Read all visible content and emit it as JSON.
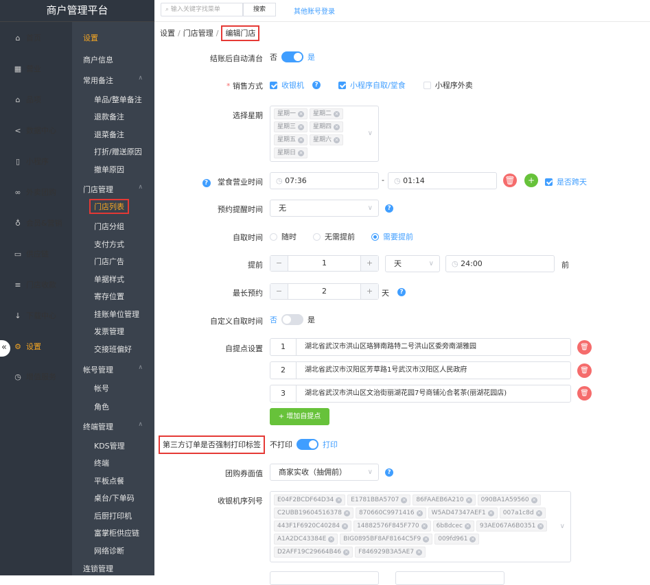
{
  "app": {
    "title": "商户管理平台"
  },
  "nav": {
    "items": [
      {
        "label": "首页",
        "icon": "home-icon",
        "glyph": "⌂"
      },
      {
        "label": "营业",
        "icon": "calendar-icon",
        "glyph": "▦"
      },
      {
        "label": "品项",
        "icon": "bag-icon",
        "glyph": "⌂"
      },
      {
        "label": "数据中心",
        "icon": "share-icon",
        "glyph": "<"
      },
      {
        "label": "小程序",
        "icon": "phone-icon",
        "glyph": "▯"
      },
      {
        "label": "外卖团购",
        "icon": "bike-icon",
        "glyph": "∞"
      },
      {
        "label": "会员&营销",
        "icon": "user-icon",
        "glyph": "♁"
      },
      {
        "label": "供应链",
        "icon": "truck-icon",
        "glyph": "▭"
      },
      {
        "label": "门店收款",
        "icon": "database-icon",
        "glyph": "≡"
      },
      {
        "label": "下载中心",
        "icon": "download-icon",
        "glyph": "↓"
      },
      {
        "label": "设置",
        "icon": "gear-icon",
        "glyph": "⚙"
      },
      {
        "label": "增值服务",
        "icon": "clock-icon",
        "glyph": "◷"
      }
    ],
    "collapse_glyph": "«"
  },
  "subnav": {
    "title": "设置",
    "groups": {
      "merchant_info": "商户信息",
      "common_remarks": "常用备注",
      "remarks": [
        "单品/整单备注",
        "退款备注",
        "退菜备注",
        "打折/赠送原因",
        "撤单原因"
      ],
      "store_mgmt": "门店管理",
      "store_items": [
        "门店列表",
        "门店分组",
        "支付方式",
        "门店广告",
        "单据样式",
        "寄存位置",
        "挂账单位管理",
        "发票管理",
        "交接班偏好"
      ],
      "account_mgmt": "帐号管理",
      "account_items": [
        "帐号",
        "角色"
      ],
      "terminal_mgmt": "终端管理",
      "terminal_items": [
        "KDS管理",
        "终端",
        "平板点餐",
        "桌台/下单码",
        "后厨打印机",
        "富掌柜供应链",
        "网络诊断"
      ],
      "conn_mgmt": "连锁管理"
    }
  },
  "topbar": {
    "search_placeholder": "输入关键字找菜单",
    "search_button": "搜索",
    "other_login": "其他账号登录"
  },
  "breadcrumb": {
    "a": "设置",
    "b": "门店管理",
    "c": "编辑门店",
    "sep": "/"
  },
  "form": {
    "auto_clear": {
      "label": "结账后自动清台",
      "off": "否",
      "on": "是",
      "value": true
    },
    "sales": {
      "label": "销售方式",
      "required": "*",
      "options": [
        {
          "label": "收银机",
          "checked": true
        },
        {
          "label": "小程序自取/堂食",
          "checked": true
        },
        {
          "label": "小程序外卖",
          "checked": false
        }
      ]
    },
    "weekday": {
      "label": "选择星期",
      "tags": [
        "星期一",
        "星期二",
        "星期三",
        "星期四",
        "星期五",
        "星期六",
        "星期日"
      ]
    },
    "dine_hours": {
      "label": "堂食营业时间",
      "start": "07:36",
      "dash": "-",
      "end": "01:14",
      "cross_day": "是否跨天",
      "cross_checked": true
    },
    "reserve_remind": {
      "label": "预约提醒时间",
      "value": "无"
    },
    "pickup": {
      "label": "自取时间",
      "options": [
        "随时",
        "无需提前",
        "需要提前"
      ],
      "selected": 2
    },
    "advance": {
      "label": "提前",
      "minus": "−",
      "value": "1",
      "plus": "+",
      "unit": "天",
      "time": "24:00",
      "suffix": "前"
    },
    "max_reserve": {
      "label": "最长预约",
      "minus": "−",
      "value": "2",
      "plus": "+",
      "unit": "天"
    },
    "custom_pickup": {
      "label": "自定义自取时间",
      "off": "否",
      "on": "是",
      "value": false
    },
    "pickup_points": {
      "label": "自提点设置",
      "items": [
        {
          "no": "1",
          "addr": "湖北省武汉市洪山区珞狮南路特二号洪山区委旁南湖雅园"
        },
        {
          "no": "2",
          "addr": "湖北省武汉市汉阳区芳草路1号武汉市汉阳区人民政府"
        },
        {
          "no": "3",
          "addr": "湖北省武汉市洪山区文治街丽湖花园7号商铺沁合茗茶(丽湖花园店)"
        }
      ],
      "add": "+ 增加自提点"
    },
    "third_party": {
      "label": "第三方订单是否强制打印标签",
      "off": "不打印",
      "on": "打印",
      "value": true
    },
    "coupon": {
      "label": "团购券面值",
      "value": "商家实收（抽佣前）"
    },
    "serials": {
      "label": "收银机序列号",
      "tags": [
        "E04F2BCDF64D34",
        "E1781BBA5707",
        "86FAAEB6A210",
        "090BA1A59560",
        "C2UBB19604516378",
        "870660C9971416",
        "W5AD47347AEF1",
        "007a1c8d",
        "443F1F6920C40284",
        "14882576F845F770",
        "6b8dcec",
        "93AE067A6B0351",
        "A1A2DC43384E",
        "BIG0895BF8AF8164C5F9",
        "009fd961",
        "D2AFF19C29664B46",
        "F846929B3A5AE7"
      ]
    }
  },
  "colors": {
    "primary": "#409eff",
    "danger": "#f56c6c",
    "success": "#67c23a",
    "active": "#f5a623",
    "highlight": "#e53935"
  }
}
